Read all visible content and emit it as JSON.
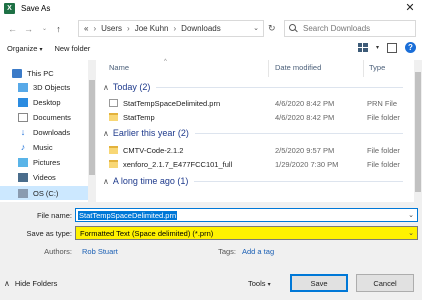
{
  "window": {
    "title": "Save As",
    "app_icon": "X",
    "close": "✕"
  },
  "address": {
    "crumbs": [
      "«",
      "Users",
      "Joe Kuhn",
      "Downloads"
    ],
    "search_placeholder": "Search Downloads"
  },
  "toolbar": {
    "organize": "Organize",
    "new_folder": "New folder"
  },
  "nav": {
    "items": [
      {
        "label": "This PC",
        "icon": "computer-icon"
      },
      {
        "label": "3D Objects",
        "icon": "3d-objects-icon"
      },
      {
        "label": "Desktop",
        "icon": "desktop-icon"
      },
      {
        "label": "Documents",
        "icon": "documents-icon"
      },
      {
        "label": "Downloads",
        "icon": "downloads-icon"
      },
      {
        "label": "Music",
        "icon": "music-icon"
      },
      {
        "label": "Pictures",
        "icon": "pictures-icon"
      },
      {
        "label": "Videos",
        "icon": "videos-icon"
      },
      {
        "label": "OS (C:)",
        "icon": "drive-icon"
      }
    ]
  },
  "list": {
    "columns": {
      "name": "Name",
      "date": "Date modified",
      "type": "Type"
    },
    "groups": [
      {
        "title": "Today (2)",
        "rows": [
          {
            "name": "StatTempSpaceDelimited.prn",
            "date": "4/6/2020 8:42 PM",
            "type": "PRN File",
            "kind": "file"
          },
          {
            "name": "StatTemp",
            "date": "4/6/2020 8:42 PM",
            "type": "File folder",
            "kind": "folder"
          }
        ]
      },
      {
        "title": "Earlier this year (2)",
        "rows": [
          {
            "name": "CMTV-Code-2.1.2",
            "date": "2/5/2020 9:57 PM",
            "type": "File folder",
            "kind": "folder"
          },
          {
            "name": "xenforo_2.1.7_E477FCC101_full",
            "date": "1/29/2020 7:30 PM",
            "type": "File folder",
            "kind": "folder"
          }
        ]
      },
      {
        "title": "A long time ago (1)",
        "rows": []
      }
    ]
  },
  "form": {
    "file_name_label": "File name:",
    "file_name_value": "StatTempSpaceDelimited.prn",
    "save_as_type_label": "Save as type:",
    "save_as_type_value": "Formatted Text (Space delimited) (*.prn)",
    "authors_label": "Authors:",
    "authors_value": "Rob Stuart",
    "tags_label": "Tags:",
    "tags_value": "Add a tag"
  },
  "footer": {
    "hide_folders": "Hide Folders",
    "tools": "Tools",
    "save": "Save",
    "cancel": "Cancel"
  },
  "colors": {
    "selection": "#0078d7",
    "highlight_type": "#fff200",
    "nav_selected": "#cce8ff"
  }
}
